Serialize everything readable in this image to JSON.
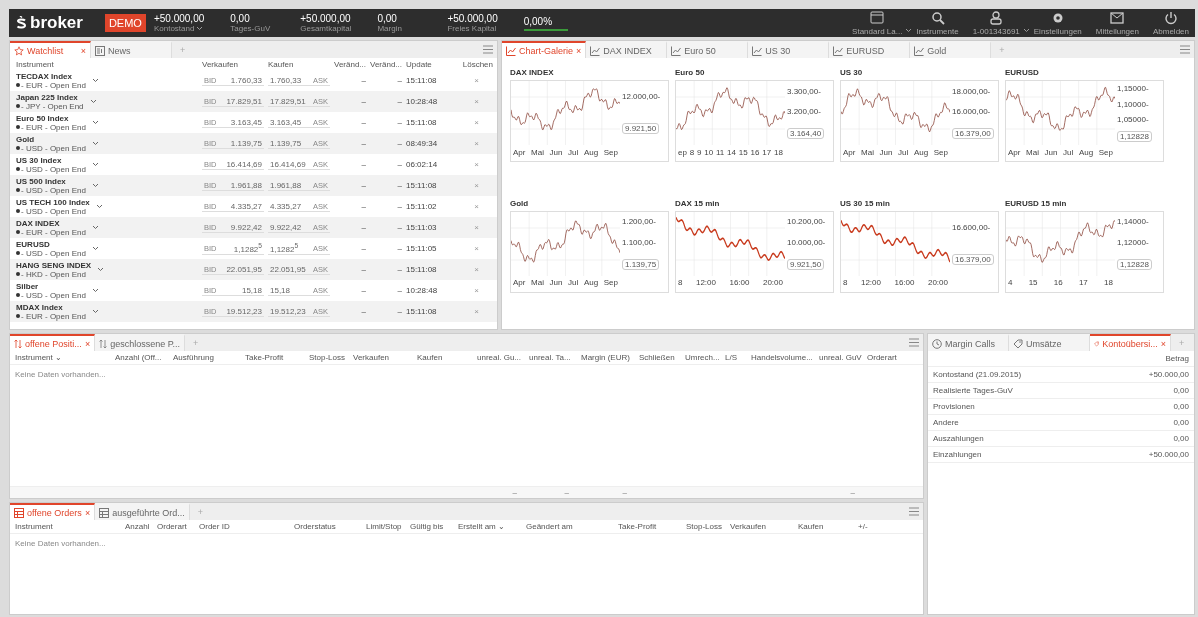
{
  "top_bar": {
    "logo": "broker",
    "mode_badge": "DEMO",
    "stats": [
      {
        "value": "+50.000,00",
        "label": "Kontostand",
        "dropdown": true
      },
      {
        "value": "0,00",
        "label": "Tages-GuV",
        "dropdown": false
      },
      {
        "value": "+50.000,00",
        "label": "Gesamtkapital",
        "dropdown": false
      },
      {
        "value": "0,00",
        "label": "Margin",
        "dropdown": false
      },
      {
        "value": "+50.000,00",
        "label": "Freies Kapital",
        "dropdown": false
      },
      {
        "value": "0,00%"
      }
    ],
    "nav": [
      {
        "kind": "layout",
        "label": "Standard La...",
        "dropdown": true
      },
      {
        "kind": "search",
        "label": "Instrumente",
        "dropdown": false
      },
      {
        "kind": "user",
        "label": "1-001343691",
        "dropdown": true
      },
      {
        "kind": "settings",
        "label": "Einstellungen",
        "dropdown": false
      },
      {
        "kind": "mail",
        "label": "Mitteilungen",
        "dropdown": false
      },
      {
        "kind": "power",
        "label": "Abmelden",
        "dropdown": false
      }
    ]
  },
  "watchlist_panel": {
    "tabs": [
      {
        "kind": "star",
        "label": "Watchlist",
        "selected": true,
        "close": "×"
      },
      {
        "kind": "news",
        "label": "News",
        "selected": false
      }
    ],
    "add_tab": "+",
    "columns": [
      "Instrument",
      "Verkaufen",
      "Kaufen",
      "Veränd...",
      "Veränd...",
      "Update",
      "Löschen"
    ],
    "rows": [
      {
        "name": "TECDAX Index",
        "detail": "- EUR - Open End",
        "bid_label": "BID",
        "bid": "1.760,33",
        "ask": "1.760,33",
        "ask_label": "ASK",
        "change_1": "–",
        "change_2": "–",
        "update": "15:11:08",
        "delete": "×"
      },
      {
        "name": "Japan 225 Index",
        "detail": "- JPY - Open End",
        "bid_label": "BID",
        "bid": "17.829,51",
        "ask": "17.829,51",
        "ask_label": "ASK",
        "change_1": "–",
        "change_2": "–",
        "update": "10:28:48",
        "delete": "×"
      },
      {
        "name": "Euro 50 Index",
        "detail": "- EUR - Open End",
        "bid_label": "BID",
        "bid": "3.163,45",
        "ask": "3.163,45",
        "ask_label": "ASK",
        "change_1": "–",
        "change_2": "–",
        "update": "15:11:08",
        "delete": "×"
      },
      {
        "name": "Gold",
        "detail": "- USD - Open End",
        "bid_label": "BID",
        "bid": "1.139,75",
        "ask": "1.139,75",
        "ask_label": "ASK",
        "change_1": "–",
        "change_2": "–",
        "update": "08:49:34",
        "delete": "×"
      },
      {
        "name": "US 30 Index",
        "detail": "- USD - Open End",
        "bid_label": "BID",
        "bid": "16.414,69",
        "ask": "16.414,69",
        "ask_label": "ASK",
        "change_1": "–",
        "change_2": "–",
        "update": "06:02:14",
        "delete": "×"
      },
      {
        "name": "US 500 Index",
        "detail": "- USD - Open End",
        "bid_label": "BID",
        "bid": "1.961,88",
        "ask": "1.961,88",
        "ask_label": "ASK",
        "change_1": "–",
        "change_2": "–",
        "update": "15:11:08",
        "delete": "×"
      },
      {
        "name": "US TECH 100 Index",
        "detail": "- USD - Open End",
        "bid_label": "BID",
        "bid": "4.335,27",
        "ask": "4.335,27",
        "ask_label": "ASK",
        "change_1": "–",
        "change_2": "–",
        "update": "15:11:02",
        "delete": "×"
      },
      {
        "name": "DAX INDEX",
        "detail": "- EUR - Open End",
        "bid_label": "BID",
        "bid": "9.922,42",
        "ask": "9.922,42",
        "ask_label": "ASK",
        "change_1": "–",
        "change_2": "–",
        "update": "15:11:03",
        "delete": "×"
      },
      {
        "name": "EURUSD",
        "detail": "- USD - Open End",
        "bid_label": "BID",
        "bid": "1,1282$^{5}$",
        "ask": "1,1282$^{5}$",
        "ask_label": "ASK",
        "change_1": "–",
        "change_2": "–",
        "update": "15:11:05",
        "delete": "×"
      },
      {
        "name": "HANG SENG INDEX",
        "detail": "- HKD - Open End",
        "bid_label": "BID",
        "bid": "22.051,95",
        "ask": "22.051,95",
        "ask_label": "ASK",
        "change_1": "–",
        "change_2": "–",
        "update": "15:11:08",
        "delete": "×"
      },
      {
        "name": "Silber",
        "detail": "- USD - Open End",
        "bid_label": "BID",
        "bid": "15,18",
        "ask": "15,18",
        "ask_label": "ASK",
        "change_1": "–",
        "change_2": "–",
        "update": "10:28:48",
        "delete": "×"
      },
      {
        "name": "MDAX Index",
        "detail": "- EUR - Open End",
        "bid_label": "BID",
        "bid": "19.512,23",
        "ask": "19.512,23",
        "ask_label": "ASK",
        "change_1": "–",
        "change_2": "–",
        "update": "15:11:08",
        "delete": "×"
      }
    ]
  },
  "chart_panel": {
    "tabs": [
      {
        "label": "Chart-Galerie",
        "selected": true,
        "close": "×"
      },
      {
        "label": "DAX INDEX",
        "selected": false
      },
      {
        "label": "Euro 50",
        "selected": false
      },
      {
        "label": "US 30",
        "selected": false
      },
      {
        "label": "EURUSD",
        "selected": false
      },
      {
        "label": "Gold",
        "selected": false
      }
    ],
    "add_tab": "+",
    "charts": [
      {
        "kind": "daily",
        "title": "DAX INDEX",
        "y_labels": [
          "12.000,00-"
        ],
        "last_price": "9.921,50",
        "x_labels": [
          "Apr",
          "Mai",
          "Jun",
          "Jul",
          "Aug",
          "Sep"
        ]
      },
      {
        "kind": "daily",
        "title": "Euro 50",
        "y_labels": [
          "3.300,00-",
          "3.200,00-"
        ],
        "last_price": "3.164,40",
        "x_labels": [
          "ep",
          "8",
          "9",
          "10",
          "11",
          "14",
          "15",
          "16",
          "17",
          "18"
        ]
      },
      {
        "kind": "daily",
        "title": "US 30",
        "y_labels": [
          "18.000,00-",
          "16.000,00-"
        ],
        "last_price": "16.379,00",
        "x_labels": [
          "Apr",
          "Mai",
          "Jun",
          "Jul",
          "Aug",
          "Sep"
        ]
      },
      {
        "kind": "daily",
        "title": "EURUSD",
        "y_labels": [
          "1,15000-",
          "1,10000-",
          "1,05000-"
        ],
        "last_price": "1,12828",
        "x_labels": [
          "Apr",
          "Mai",
          "Jun",
          "Jul",
          "Aug",
          "Sep"
        ]
      },
      {
        "kind": "daily",
        "title": "Gold",
        "y_labels": [
          "1.200,00-",
          "1.100,00-"
        ],
        "last_price": "1.139,75",
        "x_labels": [
          "Apr",
          "Mai",
          "Jun",
          "Jul",
          "Aug",
          "Sep"
        ]
      },
      {
        "kind": "intraday",
        "title": "DAX 15 min",
        "y_labels": [
          "10.200,00-",
          "10.000,00-"
        ],
        "last_price": "9.921,50",
        "x_labels": [
          "8",
          "12:00",
          "16:00",
          "20:00"
        ]
      },
      {
        "kind": "intraday",
        "title": "US 30 15 min",
        "y_labels": [
          "16.600,00-"
        ],
        "last_price": "16.379,00",
        "x_labels": [
          "8",
          "12:00",
          "16:00",
          "20:00"
        ]
      },
      {
        "kind": "daily",
        "title": "EURUSD 15 min",
        "y_labels": [
          "1,14000-",
          "1,12000-"
        ],
        "last_price": "1,12828",
        "x_labels": [
          "4",
          "15",
          "16",
          "17",
          "18"
        ]
      }
    ]
  },
  "positions_panel": {
    "tabs": [
      {
        "label": "offene Positi...",
        "selected": true,
        "close": "×"
      },
      {
        "label": "geschlossene P...",
        "selected": false
      }
    ],
    "add_tab": "+",
    "columns": [
      {
        "label": "Instrument ⌄"
      },
      {
        "label": "Anzahl (Off..."
      },
      {
        "label": "Ausführung"
      },
      {
        "label": "Take-Profit"
      },
      {
        "label": "Stop-Loss"
      },
      {
        "label": "Verkaufen"
      },
      {
        "label": "Kaufen"
      },
      {
        "label": "unreal. Gu...",
        "footer": "–"
      },
      {
        "label": "unreal. Ta...",
        "footer": "–"
      },
      {
        "label": "Margin (EUR)",
        "footer": "–"
      },
      {
        "label": "Schließen"
      },
      {
        "label": "Umrech..."
      },
      {
        "label": "L/S"
      },
      {
        "label": "Handelsvolume..."
      },
      {
        "label": "unreal. GuV",
        "footer": "–"
      },
      {
        "label": "Orderart"
      }
    ],
    "empty_text": "Keine Daten vorhanden..."
  },
  "orders_panel": {
    "tabs": [
      {
        "label": "offene Orders",
        "selected": true,
        "close": "×"
      },
      {
        "label": "ausgeführte Ord...",
        "selected": false
      }
    ],
    "add_tab": "+",
    "columns": [
      {
        "label": "Instrument"
      },
      {
        "label": "Anzahl"
      },
      {
        "label": "Orderart"
      },
      {
        "label": "Order ID"
      },
      {
        "label": "Orderstatus"
      },
      {
        "label": "Limit/Stop"
      },
      {
        "label": "Gültig bis"
      },
      {
        "label": "Erstellt am ⌄"
      },
      {
        "label": "Geändert am"
      },
      {
        "label": "Take-Profit"
      },
      {
        "label": "Stop-Loss"
      },
      {
        "label": "Verkaufen"
      },
      {
        "label": "Kaufen"
      },
      {
        "label": "+/-"
      }
    ],
    "empty_text": "Keine Daten vorhanden..."
  },
  "account_panel": {
    "tabs": [
      {
        "kind": "clock",
        "label": "Margin Calls",
        "selected": false
      },
      {
        "kind": "tag",
        "label": "Umsätze",
        "selected": false
      },
      {
        "kind": "tag",
        "label": "Kontoübersi...",
        "selected": true,
        "close": "×"
      }
    ],
    "add_tab": "+",
    "amount_header": "Betrag",
    "rows": [
      {
        "label": "Kontostand (21.09.2015)",
        "amount": "+50.000,00"
      },
      {
        "label": "Realisierte Tages-GuV",
        "amount": "0,00"
      },
      {
        "label": "Provisionen",
        "amount": "0,00"
      },
      {
        "label": "Andere",
        "amount": "0,00"
      },
      {
        "label": "Auszahlungen",
        "amount": "0,00"
      },
      {
        "label": "Einzahlungen",
        "amount": "+50.000,00"
      }
    ]
  }
}
